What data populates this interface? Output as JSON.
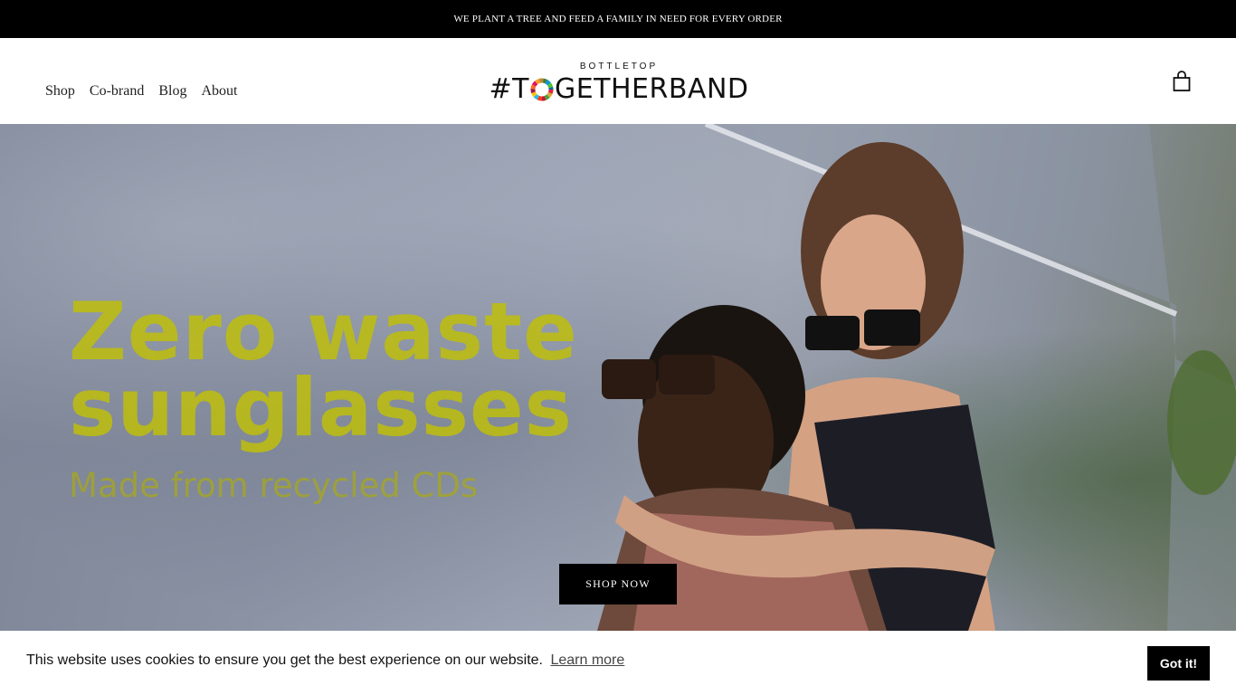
{
  "announcement": {
    "text": "WE PLANT A TREE AND FEED A FAMILY IN NEED FOR EVERY ORDER"
  },
  "nav": {
    "items": [
      {
        "label": "Shop"
      },
      {
        "label": "Co-brand"
      },
      {
        "label": "Blog"
      },
      {
        "label": "About"
      }
    ]
  },
  "logo": {
    "top": "BOTTLETOP",
    "main_prefix": "#T",
    "main_suffix": "GETHERBAND"
  },
  "icons": {
    "cart": "shopping-bag-icon",
    "logo_ring": "sdg-color-wheel-icon"
  },
  "hero": {
    "title_line1": "Zero waste",
    "title_line2": "sunglasses",
    "subtitle": "Made from recycled CDs",
    "cta_label": "SHOP NOW"
  },
  "cookie": {
    "message": "This website uses cookies to ensure you get the best experience on our website.",
    "link_label": "Learn more",
    "button_label": "Got it!"
  },
  "colors": {
    "announcement_bg": "#000000",
    "headline": "#bebe0a",
    "button_bg": "#000000"
  }
}
